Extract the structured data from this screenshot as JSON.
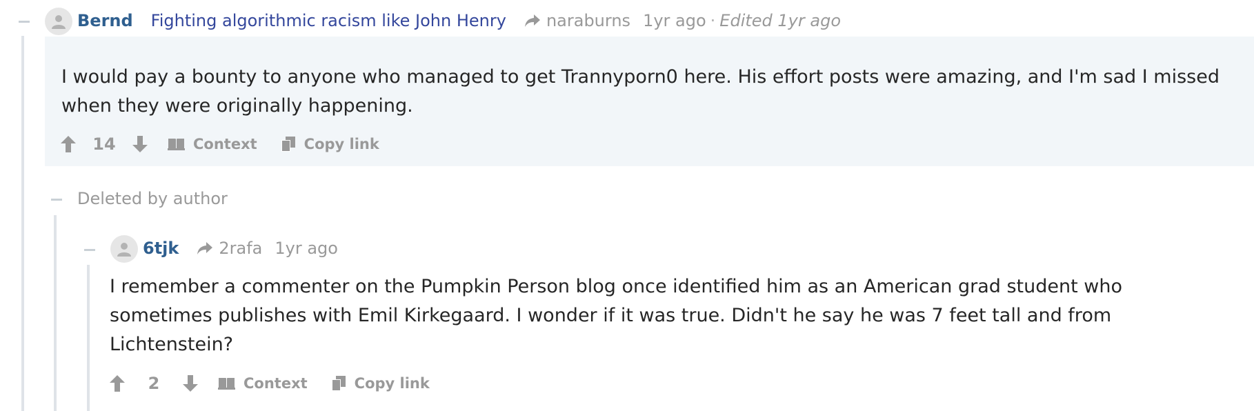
{
  "comments": [
    {
      "author": "Bernd",
      "post_title": "Fighting algorithmic racism like John Henry",
      "community": "naraburns",
      "time": "1yr ago",
      "separator": "·",
      "edited": "Edited 1yr ago",
      "body": "I would pay a bounty to anyone who managed to get Trannyporn0 here. His effort posts were amazing, and I'm sad I missed when they were originally happening.",
      "score": "14",
      "context_label": "Context",
      "copy_link_label": "Copy link"
    },
    {
      "deleted_label": "Deleted by author"
    },
    {
      "author": "6tjk",
      "community": "2rafa",
      "time": "1yr ago",
      "body": "I remember a commenter on the Pumpkin Person blog once identified him as an American grad student who sometimes publishes with Emil Kirkegaard. I wonder if it was true. Didn't he say he was 7 feet tall and from Lichtenstein?",
      "score": "2",
      "context_label": "Context",
      "copy_link_label": "Copy link"
    }
  ],
  "icons": {
    "avatar": "user-avatar-icon",
    "share": "share-arrow-icon",
    "upvote": "arrow-up-icon",
    "downvote": "arrow-down-icon",
    "context": "book-icon",
    "copy": "copy-icon",
    "collapse": "collapse-minus-icon"
  },
  "colors": {
    "username": "#2f5f8f",
    "post_link": "#34479c",
    "muted": "#999999",
    "highlight_bg": "#f2f6f9",
    "thread_line": "#dfe3e8"
  }
}
